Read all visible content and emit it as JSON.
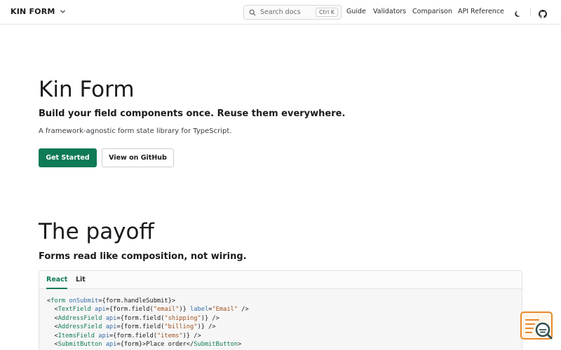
{
  "header": {
    "brand": "KIN FORM",
    "search_placeholder": "Search docs",
    "search_shortcut": "Ctrl K",
    "nav": [
      "Guide",
      "Validators",
      "Comparison",
      "API Reference"
    ],
    "icons": [
      "chevron-down-icon",
      "search-icon",
      "moon-icon",
      "github-icon"
    ]
  },
  "hero": {
    "title": "Kin Form",
    "subtitle": "Build your field components once. Reuse them everywhere.",
    "description": "A framework-agnostic form state library for TypeScript.",
    "primary_button": "Get Started",
    "secondary_button": "View on GitHub"
  },
  "payoff": {
    "title": "The payoff",
    "subtitle": "Forms read like composition, not wiring.",
    "tabs": [
      "React",
      "Lit"
    ],
    "active_tab": "React",
    "code_lines": [
      [
        {
          "t": "<",
          "k": "plain"
        },
        {
          "t": "form",
          "k": "tag"
        },
        {
          "t": " ",
          "k": "plain"
        },
        {
          "t": "onSubmit",
          "k": "attr"
        },
        {
          "t": "={form.handleSubmit}>",
          "k": "plain"
        }
      ],
      [
        {
          "t": "  <",
          "k": "plain"
        },
        {
          "t": "TextField",
          "k": "tag"
        },
        {
          "t": " ",
          "k": "plain"
        },
        {
          "t": "api",
          "k": "attr"
        },
        {
          "t": "={form.field(",
          "k": "plain"
        },
        {
          "t": "\"email\"",
          "k": "str"
        },
        {
          "t": ")} ",
          "k": "plain"
        },
        {
          "t": "label",
          "k": "attr"
        },
        {
          "t": "=",
          "k": "plain"
        },
        {
          "t": "\"Email\"",
          "k": "str"
        },
        {
          "t": " />",
          "k": "plain"
        }
      ],
      [
        {
          "t": "  <",
          "k": "plain"
        },
        {
          "t": "AddressField",
          "k": "tag"
        },
        {
          "t": " ",
          "k": "plain"
        },
        {
          "t": "api",
          "k": "attr"
        },
        {
          "t": "={form.field(",
          "k": "plain"
        },
        {
          "t": "\"shipping\"",
          "k": "str"
        },
        {
          "t": ")} />",
          "k": "plain"
        }
      ],
      [
        {
          "t": "  <",
          "k": "plain"
        },
        {
          "t": "AddressField",
          "k": "tag"
        },
        {
          "t": " ",
          "k": "plain"
        },
        {
          "t": "api",
          "k": "attr"
        },
        {
          "t": "={form.field(",
          "k": "plain"
        },
        {
          "t": "\"billing\"",
          "k": "str"
        },
        {
          "t": ")} />",
          "k": "plain"
        }
      ],
      [
        {
          "t": "  <",
          "k": "plain"
        },
        {
          "t": "ItemsField",
          "k": "tag"
        },
        {
          "t": " ",
          "k": "plain"
        },
        {
          "t": "api",
          "k": "attr"
        },
        {
          "t": "={form.field(",
          "k": "plain"
        },
        {
          "t": "\"items\"",
          "k": "str"
        },
        {
          "t": ")} />",
          "k": "plain"
        }
      ],
      [
        {
          "t": "  <",
          "k": "plain"
        },
        {
          "t": "SubmitButton",
          "k": "tag"
        },
        {
          "t": " ",
          "k": "plain"
        },
        {
          "t": "api",
          "k": "attr"
        },
        {
          "t": "={form}>Place order</",
          "k": "plain"
        },
        {
          "t": "SubmitButton",
          "k": "tag"
        },
        {
          "t": ">",
          "k": "plain"
        }
      ]
    ]
  },
  "colors": {
    "accent": "#0f7a56",
    "attr": "#3a6fa8",
    "string": "#a0521d",
    "widget": "#e8892b"
  },
  "widget": {
    "icon": "search-chat-icon"
  }
}
